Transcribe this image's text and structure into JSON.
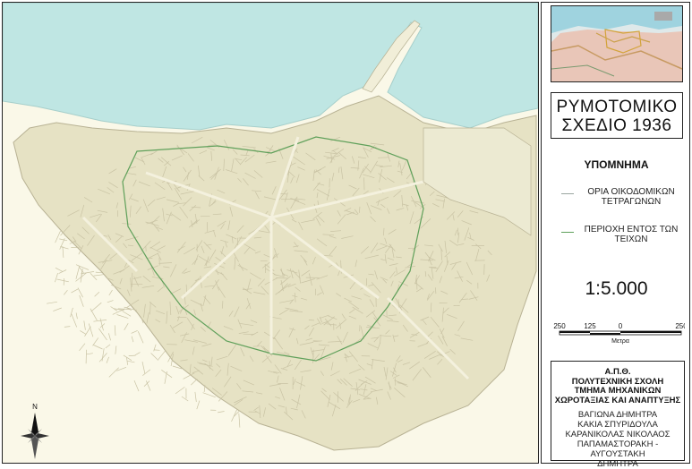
{
  "map": {
    "north_label": "N",
    "colors": {
      "sea": "#bfe6e3",
      "land": "#faf8e8",
      "blocks": "#e6e2c4",
      "streets": "#c9c3a4",
      "city_block_outline": "#8fb08a",
      "within_walls_outline": "#5fa05a"
    },
    "icons": [
      "compass-rose-icon"
    ]
  },
  "legend_panel": {
    "title_line1": "ΡΥΜΟΤΟΜΙΚΟ",
    "title_line2": "ΣΧΕΔΙΟ 1936",
    "legend_heading": "ΥΠΟΜΝΗΜΑ",
    "legend_items": [
      {
        "label": "ΟΡΙΑ ΟΙΚΟΔΟΜΙΚΩΝ ΤΕΤΡΑΓΩΝΩΝ",
        "color": "#9aa6a0"
      },
      {
        "label": "ΠΕΡΙΟΧΗ ΕΝΤΟΣ ΤΩΝ ΤΕΙΧΩΝ",
        "color": "#5fa05a"
      }
    ],
    "scale": "1:5.000",
    "scalebar": {
      "labels": [
        "250",
        "125",
        "0",
        "250"
      ],
      "unit": "Μετρα"
    },
    "institution": [
      "Α.Π.Θ.",
      "ΠΟΛΥΤΕΧΝΙΚΗ ΣΧΟΛΗ",
      "ΤΜΗΜΑ ΜΗΧΑΝΙΚΩΝ",
      "ΧΩΡΟΤΑΞΙΑΣ ΚΑΙ ΑΝΑΠΤΥΞΗΣ"
    ],
    "authors": [
      "ΒΑΓΙΩΝΑ ΔΗΜΗΤΡΑ",
      "ΚΑΚΙΑ ΣΠΥΡΙΔΟΥΛΑ",
      "ΚΑΡΑΝΙΚΟΛΑΣ ΝΙΚΟΛΑΟΣ",
      "ΠΑΠΑΜΑΣΤΟΡΑΚΗ - ΑΥΓΟΥΣΤΑΚΗ",
      "ΔΗΜΗΤΡΑ"
    ]
  }
}
